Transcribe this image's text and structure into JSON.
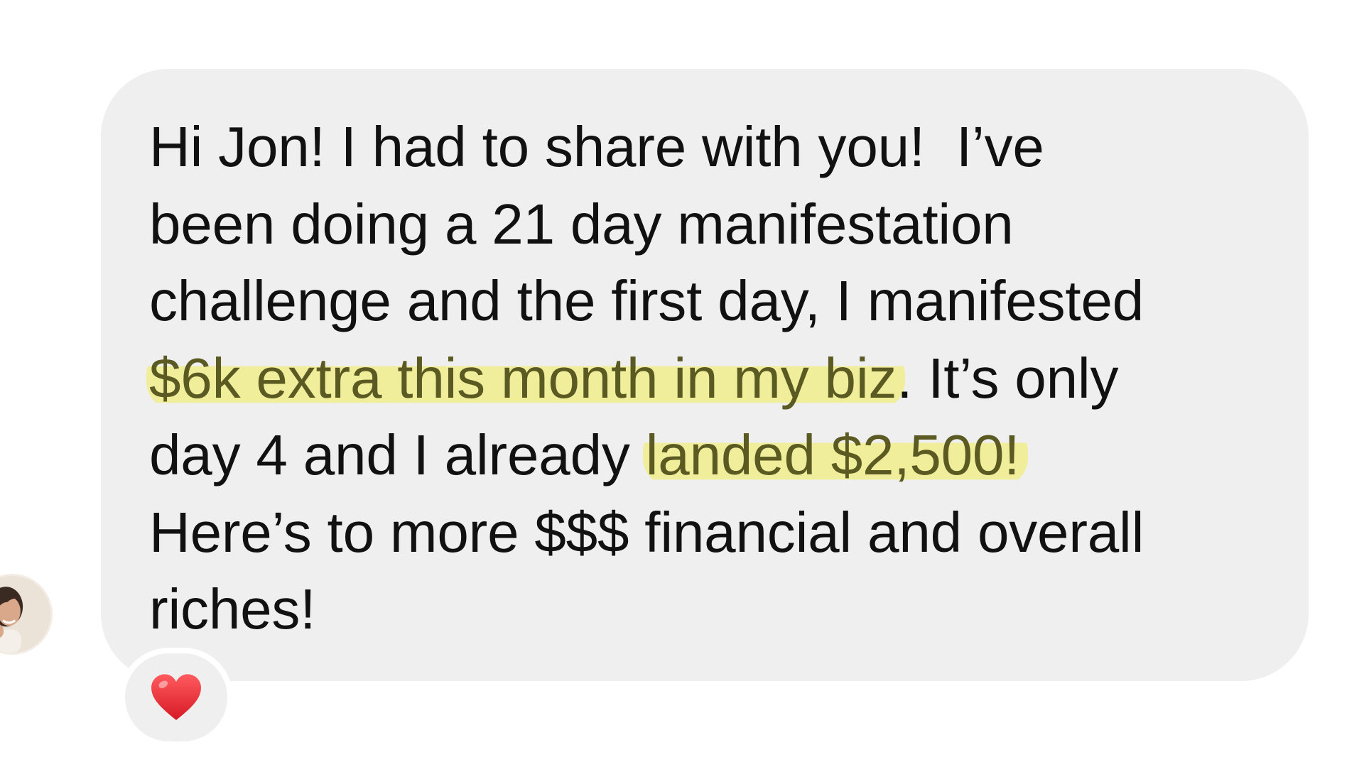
{
  "thread": {
    "avatar_icon": "user-avatar-photo",
    "message": {
      "line1": "Hi Jon! I had to share with you!  I’ve",
      "line2": "been doing a 21 day manifestation",
      "line3": "challenge and the first day, I manifested",
      "line4_highlight": "$6k extra this month in my biz",
      "line4_rest": ". It’s only",
      "line5_start": "day 4 and I already ",
      "line5_highlight": "landed $2,500!",
      "line6": "Here’s to more $$$ financial and overall",
      "line7": "riches!"
    },
    "reaction": {
      "icon": "red-heart-icon",
      "color": "#e8242c"
    },
    "colors": {
      "bubble": "#efefef",
      "highlight": "#f0ee8c",
      "text": "#111111"
    }
  }
}
